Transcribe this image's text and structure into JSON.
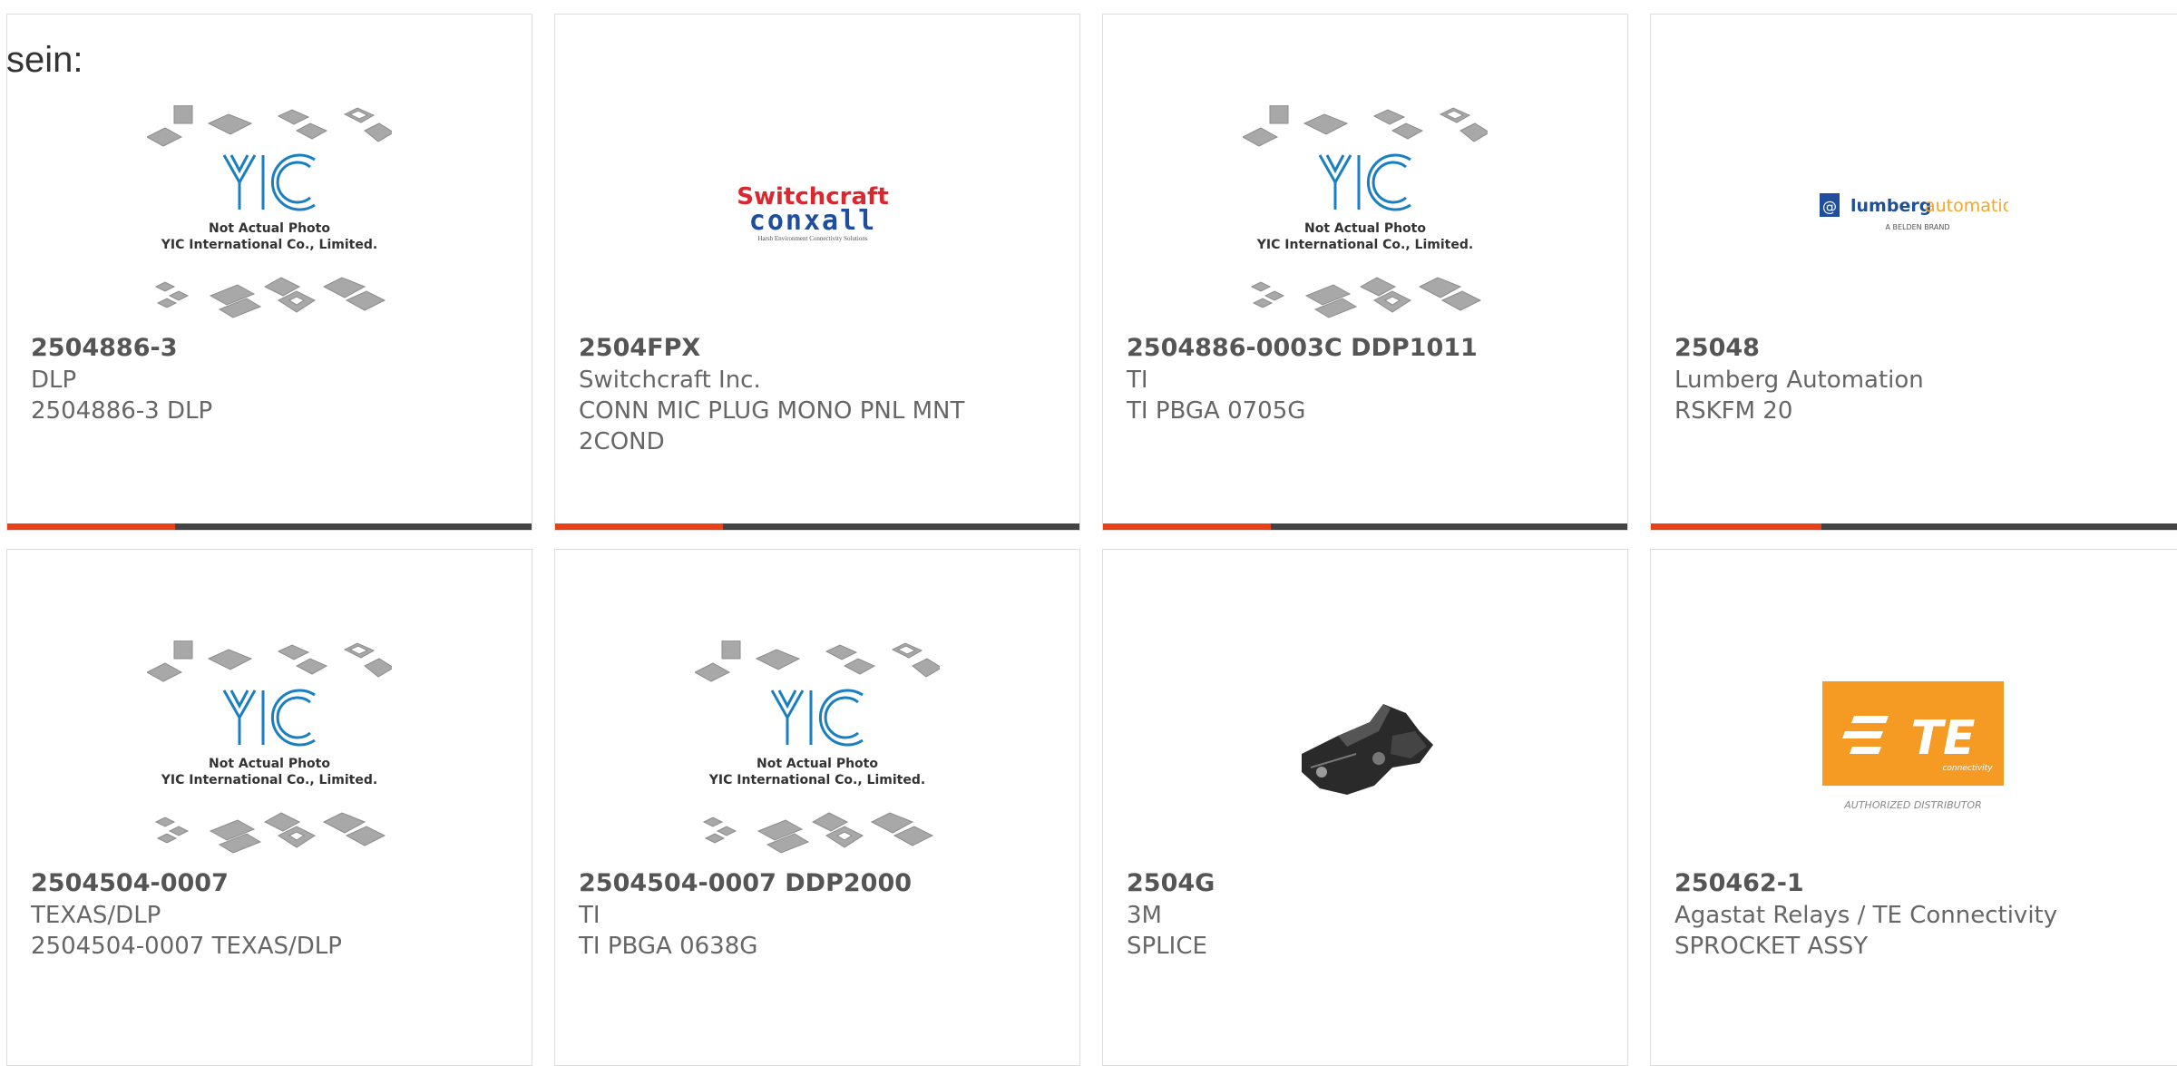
{
  "page_label": "sein:",
  "colors": {
    "accent": "#e84118",
    "bar_track": "#444444",
    "card_border": "#dddddd",
    "yic_blue": "#1a7fc1",
    "te_orange": "#f59a23"
  },
  "placeholder": {
    "line1": "Not Actual Photo",
    "line2": "YIC International Co., Limited.",
    "mark": "YIC"
  },
  "logos": {
    "switchcraft": {
      "top": "Switchcraft",
      "bottom": "conxall",
      "tagline": "Harsh Environment Connectivity Solutions"
    },
    "lumberg": {
      "name": "lumberg",
      "suffix": "automation",
      "sub": "A BELDEN BRAND",
      "badge": "@"
    },
    "te": {
      "name": "TE",
      "sub": "connectivity",
      "caption": "AUTHORIZED DISTRIBUTOR"
    }
  },
  "products": [
    {
      "part_number": "2504886-3",
      "manufacturer": "DLP",
      "description": "2504886-3 DLP",
      "image": "yic-placeholder",
      "progress": 0.32
    },
    {
      "part_number": "2504FPX",
      "manufacturer": "Switchcraft Inc.",
      "description": "CONN MIC PLUG MONO PNL MNT 2COND",
      "image": "switchcraft-logo",
      "progress": 0.32
    },
    {
      "part_number": "2504886-0003C DDP1011",
      "manufacturer": "TI",
      "description": "TI PBGA 0705G",
      "image": "yic-placeholder",
      "progress": 0.32
    },
    {
      "part_number": "25048",
      "manufacturer": "Lumberg Automation",
      "description": "RSKFM 20",
      "image": "lumberg-logo",
      "progress": 0.32
    },
    {
      "part_number": "2504504-0007",
      "manufacturer": "TEXAS/DLP",
      "description": "2504504-0007 TEXAS/DLP",
      "image": "yic-placeholder"
    },
    {
      "part_number": "2504504-0007 DDP2000",
      "manufacturer": "TI",
      "description": "TI PBGA 0638G",
      "image": "yic-placeholder"
    },
    {
      "part_number": "2504G",
      "manufacturer": "3M",
      "description": "SPLICE",
      "image": "splice-photo"
    },
    {
      "part_number": "250462-1",
      "manufacturer": "Agastat Relays / TE Connectivity",
      "description": "SPROCKET ASSY",
      "image": "te-logo"
    }
  ]
}
